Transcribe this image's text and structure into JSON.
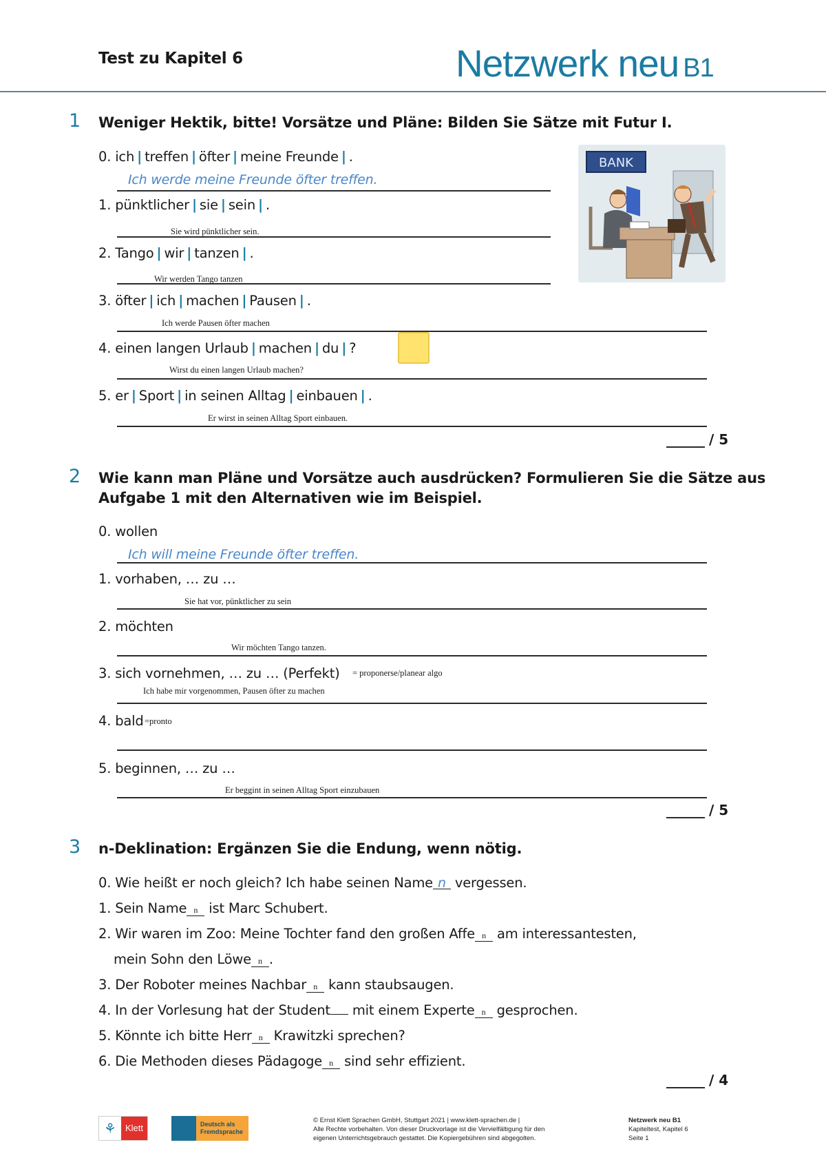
{
  "header": {
    "title": "Test zu Kapitel 6",
    "brand": "Netzwerk neu",
    "level": "B1"
  },
  "task1": {
    "number": "1",
    "title": "Weniger Hektik, bitte! Vorsätze und Pläne: Bilden Sie Sätze mit Futur I.",
    "items": [
      {
        "num": "0.",
        "parts": [
          "ich",
          "treffen",
          "öfter",
          "meine Freunde"
        ],
        "end": ".",
        "answer": "Ich werde meine Freunde öfter treffen.",
        "is_example": true
      },
      {
        "num": "1.",
        "parts": [
          "pünktlicher",
          "sie",
          "sein"
        ],
        "end": ".",
        "answer": "Sie wird pünktlicher sein."
      },
      {
        "num": "2.",
        "parts": [
          "Tango",
          "wir",
          "tanzen"
        ],
        "end": ".",
        "answer": "Wir werden Tango tanzen"
      },
      {
        "num": "3.",
        "parts": [
          "öfter",
          "ich",
          "machen",
          "Pausen"
        ],
        "end": ".",
        "answer": "Ich werde Pausen öfter machen"
      },
      {
        "num": "4.",
        "parts": [
          "einen langen Urlaub",
          "machen",
          "du"
        ],
        "end": "?",
        "answer": "Wirst du einen langen Urlaub machen?"
      },
      {
        "num": "5.",
        "parts": [
          "er",
          "Sport",
          "in seinen Alltag",
          "einbauen"
        ],
        "end": ".",
        "answer": "Er wirst in seinen Alltag Sport einbauen."
      }
    ],
    "score_max": "/ 5",
    "illustration": {
      "sign": "BANK"
    }
  },
  "task2": {
    "number": "2",
    "title_line1": "Wie kann man Pläne und Vorsätze auch ausdrücken? Formulieren Sie die Sätze aus",
    "title_line2": "Aufgabe 1 mit den Alternativen wie im Beispiel.",
    "items": [
      {
        "label": "0. wollen",
        "answer": "Ich will meine Freunde öfter treffen.",
        "is_example": true
      },
      {
        "label": "1. vorhaben, … zu …",
        "answer": "Sie hat vor, pünktlicher zu sein"
      },
      {
        "label": "2. möchten",
        "answer": "Wir  möchten Tango tanzen."
      },
      {
        "label": "3. sich vornehmen, … zu … (Perfekt)",
        "note": "= proponerse/planear algo",
        "answer": "Ich habe mir vorgenommen, Pausen öfter zu machen"
      },
      {
        "label": "4. bald",
        "note": "=pronto",
        "answer": ""
      },
      {
        "label": "5. beginnen, … zu …",
        "answer": "Er beggint in seinen Alltag Sport einzubauen"
      }
    ],
    "score_max": "/ 5"
  },
  "task3": {
    "number": "3",
    "title": "n-Deklination: Ergänzen Sie die Endung, wenn nötig.",
    "items": [
      {
        "before": "0. Wie heißt er noch gleich? Ich habe seinen Name",
        "fill": "n",
        "after": " vergessen.",
        "is_example": true
      },
      {
        "before": "1. Sein Name",
        "fill": "n",
        "after": " ist Marc Schubert."
      },
      {
        "before": "2. Wir waren im Zoo: Meine Tochter fand den großen Affe",
        "fill": "n",
        "after": " am interessantesten,"
      },
      {
        "before": "mein Sohn den Löwe",
        "fill": "n",
        "after": "."
      },
      {
        "before": "3. Der Roboter meines Nachbar",
        "fill": "n",
        "after": " kann staubsaugen."
      },
      {
        "before": "4. In der Vorlesung hat der Student",
        "fill": "",
        "mid": " mit einem Experte",
        "fill2": "n",
        "after": " gesprochen."
      },
      {
        "before": "5. Könnte ich bitte Herr",
        "fill": "n",
        "after": " Krawitzki sprechen?"
      },
      {
        "before": "6. Die Methoden dieses Pädagoge",
        "fill": "n",
        "after": " sind sehr effizient."
      }
    ],
    "score_max": "/ 4"
  },
  "footer": {
    "klett_logo": "Klett",
    "daf_logo_line1": "Deutsch als",
    "daf_logo_line2": "Fremdsprache",
    "copyright_line1": "© Ernst Klett Sprachen GmbH, Stuttgart 2021 | www.klett-sprachen.de |",
    "copyright_line2": "Alle Rechte vorbehalten. Von dieser Druckvorlage ist die Vervielfältigung für den",
    "copyright_line3": "eigenen Unterrichtsgebrauch gestattet. Die Kopiergebühren sind abgegolten.",
    "book": "Netzwerk neu B1",
    "test": "Kapiteltest, Kapitel 6",
    "page": "Seite 1"
  },
  "colors": {
    "accent": "#1b7ba3",
    "example_text": "#4a86c8",
    "sticky_note": "#ffe36e"
  }
}
